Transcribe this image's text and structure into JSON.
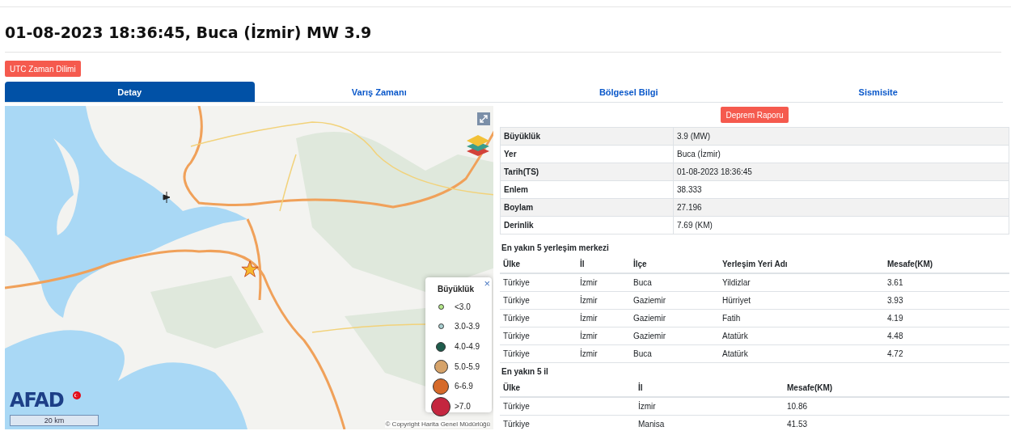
{
  "title": "01-08-2023 18:36:45, Buca (İzmir) MW 3.9",
  "timezone_button": "UTC Zaman Dilimi",
  "tabs": [
    {
      "label": "Detay",
      "selected": true
    },
    {
      "label": "Varış Zamanı",
      "selected": false
    },
    {
      "label": "Bölgesel Bilgi",
      "selected": false
    },
    {
      "label": "Sismisite",
      "selected": false
    }
  ],
  "map": {
    "logo": "AFAD",
    "scale": "20 km",
    "copyright": "© Copyright Harita Genel Müdürlüğü",
    "legend": {
      "title": "Büyüklük",
      "close": "×",
      "items": [
        {
          "label": "<3.0",
          "color": "#b5e88a"
        },
        {
          "label": "3.0-3.9",
          "color": "#a9cfd0"
        },
        {
          "label": "4.0-4.9",
          "color": "#1f5c4c"
        },
        {
          "label": "5.0-5.9",
          "color": "#d6a36a"
        },
        {
          "label": "6-6.9",
          "color": "#d66a2a"
        },
        {
          "label": ">7.0",
          "color": "#c4263f"
        }
      ]
    }
  },
  "report_button": "Deprem Raporu",
  "details": [
    {
      "label": "Büyüklük",
      "value": "3.9 (MW)"
    },
    {
      "label": "Yer",
      "value": "Buca (İzmir)"
    },
    {
      "label": "Tarih(TS)",
      "value": "01-08-2023 18:36:45"
    },
    {
      "label": "Enlem",
      "value": "38.333"
    },
    {
      "label": "Boylam",
      "value": "27.196"
    },
    {
      "label": "Derinlik",
      "value": "7.69 (KM)"
    }
  ],
  "nearest_settlements": {
    "title": "En yakın 5 yerleşim merkezi",
    "columns": [
      "Ülke",
      "İl",
      "İlçe",
      "Yerleşim Yeri Adı",
      "Mesafe(KM)"
    ],
    "rows": [
      [
        "Türkiye",
        "İzmir",
        "Buca",
        "Yildizlar",
        "3.61"
      ],
      [
        "Türkiye",
        "İzmir",
        "Gaziemir",
        "Hürriyet",
        "3.93"
      ],
      [
        "Türkiye",
        "İzmir",
        "Gaziemir",
        "Fatih",
        "4.19"
      ],
      [
        "Türkiye",
        "İzmir",
        "Gaziemir",
        "Atatürk",
        "4.48"
      ],
      [
        "Türkiye",
        "İzmir",
        "Buca",
        "Atatürk",
        "4.72"
      ]
    ]
  },
  "nearest_provinces": {
    "title": "En yakın 5 il",
    "columns": [
      "Ülke",
      "İl",
      "Mesafe(KM)"
    ],
    "rows": [
      [
        "Türkiye",
        "İzmir",
        "10.86"
      ],
      [
        "Türkiye",
        "Manisa",
        "41.53"
      ]
    ]
  }
}
